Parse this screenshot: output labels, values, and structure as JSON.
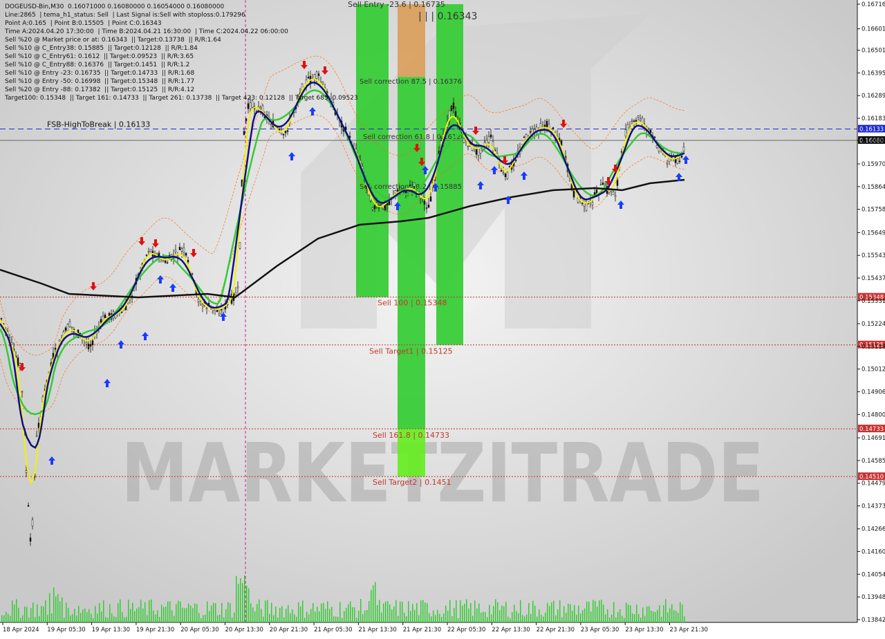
{
  "info_lines": [
    "DOGEUSD-Bin,M30  0.16071000 0.16080000 0.16054000 0.16080000",
    "Line:2865  | tema_h1_status: Sell  | Last Signal is:Sell with stoploss:0.179296",
    "Point A:0.165  | Point B:0.15505  | Point C:0.16343",
    "Time A:2024.04.20 17:30:00  | Time B:2024.04.21 16:30:00  | Time C:2024.04.22 06:00:00",
    "Sell %20 @ Market price or at: 0.16343  || Target:0.13738  || R/R:1.64",
    "Sell %10 @ C_Entry38: 0.15885  || Target:0.12128  || R/R:1.84",
    "Sell %10 @ C_Entry61: 0.1612  || Target:0.09523  || R/R:3.65",
    "Sell %10 @ C_Entry88: 0.16376  || Target:0.1451  || R/R:1.2",
    "Sell %10 @ Entry -23: 0.16735  || Target:0.14733  || R/R:1.68",
    "Sell %10 @ Entry -50: 0.16998  || Target:0.15348  || R/R:1.77",
    "Sell %20 @ Entry -88: 0.17382  || Target:0.15125  || R/R:4.12",
    "Target100: 0.15348  || Target 161: 0.14733  || Target 261: 0.13738  || Target 423: 0.12128  || Target 685: 0.09523"
  ],
  "chart_data": {
    "type": "line",
    "symbol": "DOGEUSD-Bin,M30",
    "price_axis_ticks": [
      "0.16716",
      "0.16601",
      "0.16501",
      "0.16395",
      "0.16289",
      "0.16183",
      "0.16080",
      "0.15970",
      "0.15864",
      "0.15758",
      "0.15649",
      "0.15543",
      "0.15437",
      "0.15331",
      "0.15224",
      "0.15118",
      "0.15012",
      "0.14906",
      "0.14800",
      "0.14691",
      "0.14585",
      "0.14479",
      "0.14373",
      "0.14266",
      "0.14160",
      "0.14054",
      "0.13948",
      "0.13842"
    ],
    "time_axis_ticks": [
      "18 Apr 2024",
      "19 Apr 05:30",
      "19 Apr 13:30",
      "19 Apr 21:30",
      "20 Apr 05:30",
      "20 Apr 13:30",
      "20 Apr 21:30",
      "21 Apr 05:30",
      "21 Apr 13:30",
      "21 Apr 21:30",
      "22 Apr 05:30",
      "22 Apr 13:30",
      "22 Apr 21:30",
      "23 Apr 05:30",
      "23 Apr 13:30",
      "23 Apr 21:30"
    ],
    "ylim": [
      0.13842,
      0.16716
    ],
    "current_price": 0.1608,
    "current_price_label": "0.16080",
    "levels": [
      {
        "label": "FSB-HighToBreak | 0.16133",
        "value": 0.16133,
        "color": "#1f2bd0",
        "axis_label": "0.16133",
        "style": "dash"
      },
      {
        "label": "Sell 100 | 0.15348",
        "value": 0.15348,
        "color": "#c83232",
        "axis_label": "0.15348",
        "style": "dot"
      },
      {
        "label": "Sell Target1 | 0.15125",
        "value": 0.15125,
        "color": "#c83232",
        "axis_label": "0.15125",
        "style": "dot"
      },
      {
        "label": "Sell 161.8 | 0.14733",
        "value": 0.14733,
        "color": "#c83232",
        "axis_label": "0.14733",
        "style": "dot"
      },
      {
        "label": "Sell Target2 | 0.1451",
        "value": 0.1451,
        "color": "#c83232",
        "axis_label": "0.14510",
        "style": "dot"
      }
    ],
    "zone_labels": [
      {
        "text": "Sell Entry -23.6 | 0.16735",
        "value": 0.16735
      },
      {
        "text": "| | | 0.16343",
        "value": 0.16343
      },
      {
        "text": "Sell correction 87.5 | 0.16376",
        "value": 0.16376
      },
      {
        "text": "Sell correction 61.8 | 0.1612",
        "value": 0.1612
      },
      {
        "text": "Sell correction 38.2 | 0.15885",
        "value": 0.15885
      }
    ],
    "zone_colors": {
      "green": "#33cc33",
      "orange": "#d9a05b",
      "bright_green": "#66ee22"
    },
    "series_colors": {
      "price": "#111111",
      "yellow": "#f2f200",
      "blue": "#101080",
      "green": "#33cc33",
      "black": "#111111",
      "envelope": "#ff6600",
      "volume": "#33cc33"
    },
    "watermark": "MARKETZITRADE"
  }
}
